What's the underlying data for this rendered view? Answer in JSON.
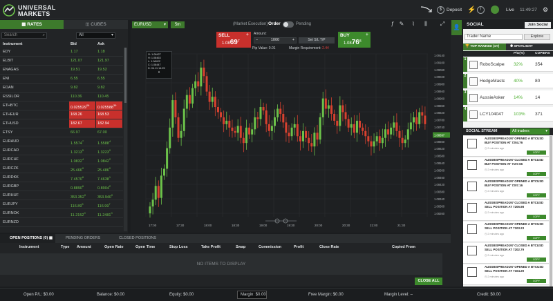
{
  "header": {
    "brand_line1": "UNIVERSAL",
    "brand_line2": "MARKETS",
    "deposit": "Deposit",
    "account_type": "Live",
    "clock": "11:49:27"
  },
  "rates_panel": {
    "tab_rates": "RATES",
    "tab_cubes": "CUBES",
    "search_placeholder": "Search",
    "filter_value": "All",
    "col_instrument": "Instrument",
    "col_bid": "Bid",
    "col_ask": "Ask",
    "rows": [
      {
        "name": "EDY",
        "bid": "1.17",
        "ask": "1.18",
        "hl": false
      },
      {
        "name": "ELBIT",
        "bid": "121.07",
        "ask": "121.97",
        "hl": false
      },
      {
        "name": "ENAGAS",
        "bid": "19.51",
        "ask": "19.52",
        "hl": false
      },
      {
        "name": "ENI",
        "bid": "6.55",
        "ask": "6.55",
        "hl": false
      },
      {
        "name": "EOAN",
        "bid": "9.82",
        "ask": "9.82",
        "hl": false
      },
      {
        "name": "ESSILOR",
        "bid": "110.36",
        "ask": "110.45",
        "hl": false
      },
      {
        "name": "ETHBTC",
        "bid": "0.025529",
        "bid_sup": "06",
        "ask": "0.025588",
        "ask_sup": "39",
        "hl": true
      },
      {
        "name": "ETHEUR",
        "bid": "168.26",
        "ask": "168.53",
        "hl": true
      },
      {
        "name": "ETHUSD",
        "bid": "182.67",
        "ask": "182.94",
        "hl": true
      },
      {
        "name": "ETSY",
        "bid": "66.97",
        "ask": "67.00",
        "hl": false
      },
      {
        "name": "EURAUD",
        "bid": "1.5574",
        "bid_sup": "7",
        "ask": "1.5588",
        "ask_sup": "4",
        "hl": false
      },
      {
        "name": "EURCAD",
        "bid": "1.3213",
        "bid_sup": "5",
        "ask": "1.3223",
        "ask_sup": "0",
        "hl": false
      },
      {
        "name": "EURCHF",
        "bid": "1.0832",
        "bid_sup": "4",
        "ask": "1.0842",
        "ask_sup": "2",
        "hl": false
      },
      {
        "name": "EURCZK",
        "bid": "25.466",
        "bid_sup": "0",
        "ask": "25.486",
        "ask_sup": "0",
        "hl": false
      },
      {
        "name": "EURDKK",
        "bid": "7.4570",
        "bid_sup": "6",
        "ask": "7.4638",
        "ask_sup": "1",
        "hl": false
      },
      {
        "name": "EURGBP",
        "bid": "0.8890",
        "bid_sup": "6",
        "ask": "0.8904",
        "ask_sup": "2",
        "hl": false
      },
      {
        "name": "EURHUF",
        "bid": "353.352",
        "bid_sup": "0",
        "ask": "353.940",
        "ask_sup": "0",
        "hl": false
      },
      {
        "name": "EURJPY",
        "bid": "116.89",
        "bid_sup": "5",
        "ask": "116.99",
        "ask_sup": "7",
        "hl": false
      },
      {
        "name": "EURNOK",
        "bid": "11.2152",
        "bid_sup": "0",
        "ask": "11.2481",
        "ask_sup": "0",
        "hl": false
      },
      {
        "name": "EURNZD",
        "bid": "",
        "ask": "",
        "hl": false
      }
    ]
  },
  "chart_panel": {
    "symbol": "EURUSD",
    "timeframe": "5m",
    "market_exec": "(Market Execution)",
    "order_label": "Order",
    "pending_label": "Pending",
    "sell_label": "SELL",
    "sell_price_prefix": "1.08",
    "sell_price_big": "69",
    "sell_price_sup": "7",
    "buy_label": "BUY",
    "buy_price_prefix": "1.08",
    "buy_price_big": "76",
    "buy_price_sup": "8",
    "amount_label": "Amount:",
    "amount_value": "1000",
    "sltp_label": "Set S/L T/P",
    "pip_value": "Pip Value: 0.01",
    "margin_req_label": "Margin Requirement:",
    "margin_req_value": "2.44",
    "ohlc": [
      "O: 1.08427",
      "H: 1.08463",
      "L: 1.08422",
      "C: 1.08447",
      "D: 04.11 14:25"
    ],
    "current_price_tag": "1.08697",
    "y_ticks": [
      "1.09140",
      "1.09100",
      "1.09060",
      "1.09020",
      "1.08980",
      "1.08940",
      "1.08900",
      "1.08860",
      "1.08820",
      "1.08780",
      "1.08740",
      "1.08700",
      "1.08660",
      "1.08620",
      "1.08580",
      "1.08540",
      "1.08500",
      "1.08460",
      "1.08420",
      "1.08380",
      "1.08340",
      "1.08300",
      "1.08260"
    ],
    "x_ticks": [
      "17:00",
      "17:30",
      "18:00",
      "18:30",
      "19:00",
      "19:30",
      "20:00",
      "20:30",
      "21:00",
      "21:30"
    ]
  },
  "chart_data": {
    "type": "candlestick",
    "symbol": "EURUSD",
    "interval": "5m",
    "ylim": [
      1.0822,
      1.0917
    ],
    "up_color": "#6cc24a",
    "down_color": "#d8412f",
    "closes": [
      1.0828,
      1.0832,
      1.084,
      1.0833,
      1.0846,
      1.085,
      1.0862,
      1.0874,
      1.089,
      1.088,
      1.0868,
      1.0872,
      1.0885,
      1.0893,
      1.0888,
      1.0897,
      1.0901,
      1.0898,
      1.0909,
      1.0904,
      1.0895,
      1.0889,
      1.0892,
      1.0886,
      1.0883,
      1.088,
      1.0876,
      1.0878,
      1.0874,
      1.0872,
      1.0871,
      1.0875,
      1.0868,
      1.0865,
      1.0874,
      1.087,
      1.0873,
      1.088,
      1.0879,
      1.0886,
      1.0884,
      1.0876,
      1.0872,
      1.0875,
      1.088,
      1.0885,
      1.0882,
      1.0877,
      1.0871,
      1.0869,
      1.0874,
      1.0876,
      1.0869,
      1.0866,
      1.0872,
      1.0868,
      1.0865,
      1.0863,
      1.0871,
      1.0867,
      1.088,
      1.0891,
      1.0885,
      1.0887,
      1.0882,
      1.0878,
      1.0875,
      1.0887,
      1.0883,
      1.0879,
      1.0874,
      1.0876,
      1.0871,
      1.0878,
      1.0874,
      1.0872,
      1.0869,
      1.0866,
      1.0863,
      1.0866,
      1.0869,
      1.0865,
      1.0868,
      1.0873,
      1.087,
      1.0874,
      1.0877,
      1.0872,
      1.0868,
      1.0865,
      1.0867,
      1.0873,
      1.0877,
      1.088,
      1.0876,
      1.0883,
      1.0881,
      1.0876
    ]
  },
  "positions_panel": {
    "tab_open": "OPEN POSITIONS (0)",
    "tab_pending": "PENDING ORDERS",
    "tab_closed": "CLOSED POSITIONS",
    "cols": [
      "Instrument",
      "Type",
      "Amount",
      "Open Rate",
      "Open Time",
      "Stop Loss",
      "Take Profit",
      "Swap",
      "Commission",
      "Profit",
      "Close Rate",
      "Copied From"
    ],
    "empty": "NO ITEMS TO DISPLAY",
    "close_all": "CLOSE ALL"
  },
  "social_panel": {
    "title": "SOCIAL",
    "join": "Join Social",
    "trader_placeholder": "Trader Name",
    "explore": "Explore",
    "tab_top": "TOP RANKED (1Y)",
    "tab_spot": "SPOTLIGHT",
    "col_pg": "P/G(%)",
    "col_copiers": "COPIERS",
    "ranked": [
      {
        "rank": "1",
        "name": "RoboScalper",
        "pg": "32%",
        "copiers": "354"
      },
      {
        "rank": "2",
        "name": "HedgeMaster",
        "pg": "40%",
        "copiers": "80"
      },
      {
        "rank": "3",
        "name": "AussieAsker",
        "pg": "14%",
        "copiers": "14"
      },
      {
        "rank": "4",
        "name": "LCY104047",
        "pg": "103%",
        "copiers": "371"
      }
    ],
    "stream_title": "SOCIAL STREAM",
    "stream_filter": "All traders",
    "stream": [
      {
        "l1": "AUSSIESPREAD197 OPENED A BTCUSD",
        "l2": "BUY POSITION AT 7204.76",
        "time": "2 minutes ago",
        "copy": "COPY"
      },
      {
        "l1": "AUSSIESPREAD197 CLOSED A BTCUSD",
        "l2": "BUY POSITION AT 7107.66",
        "time": "2 minutes ago",
        "copy": "COPY"
      },
      {
        "l1": "AUSSIESPREAD197 OPENED A BTCUSD",
        "l2": "BUY POSITION AT 7207.16",
        "time": "2 minutes ago",
        "copy": "COPY"
      },
      {
        "l1": "AUSSIESPREAD197 CLOSED A BTCUSD",
        "l2": "SELL POSITION AT 7206.98",
        "time": "2 minutes ago",
        "copy": "COPY"
      },
      {
        "l1": "AUSSIESPREAD197 OPENED A BTCUSD",
        "l2": "SELL POSITION AT 7103.23",
        "time": "2 minutes ago",
        "copy": "COPY"
      },
      {
        "l1": "AUSSIESPREAD197 CLOSED A BTCUSD",
        "l2": "SELL POSITION AT 7202.79",
        "time": "2 minutes ago",
        "copy": "COPY"
      },
      {
        "l1": "AUSSIESPREAD197 OPENED A BTCUSD",
        "l2": "SELL POSITION AT 7104.29",
        "time": "2 minutes ago",
        "copy": "COPY"
      }
    ]
  },
  "footer": {
    "open_pl": "Open P/L: $0.00",
    "balance": "Balance: $0.00",
    "equity": "Equity: $0.00",
    "margin": "Margin: $0.00",
    "free_margin": "Free Margin: $0.00",
    "margin_level": "Margin Level: –",
    "credit": "Credit: $0.00"
  },
  "colors": {
    "accent_green": "#3d7a2c",
    "sell_red": "#c8302c",
    "background": "#1b1d1f"
  }
}
